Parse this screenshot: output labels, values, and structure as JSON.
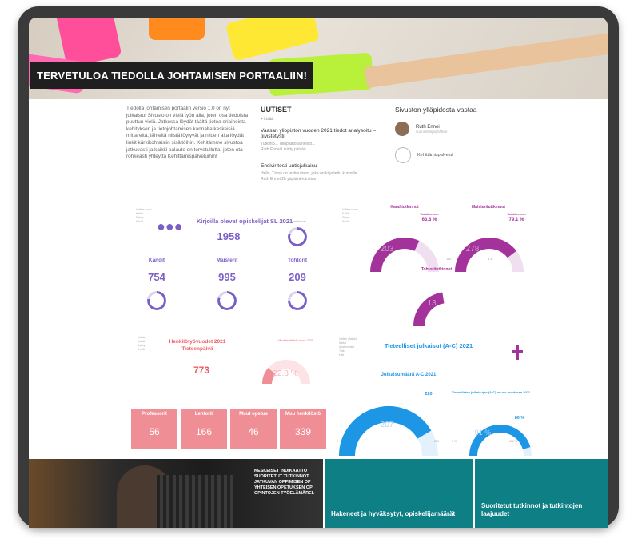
{
  "hero": {
    "title": "TERVETULOA TIEDOLLA JOHTAMISEN PORTAALIIN!"
  },
  "intro": {
    "text": "Tiedolla johtamisen portaalin versio 1.0 on nyt julkaistu! Sivusto on vielä työn alla, joten osa tiedoista puuttuu vielä. Jatkossa löydät täältä tietoa eriaiheista kehityksen ja tietojohtamisen kannalta keskeisiä mittareita, lähteitä niistä löytyvät ja niiden alta löydät linkit kärkikohtaisiin sisältöihin. Kehitämme sivustoa jatkuvasti ja kaikki palaute on tervetullutta, joten ota rohkeasti yhteyttä Kehittämispalveluihin!"
  },
  "news": {
    "heading": "UUTISET",
    "add_label": "+ Lisää",
    "items": [
      {
        "title": "Vaasan yliopiston vuoden 2021 tiedot analysoitu – tiivistetysti",
        "snippet": "Tutkinto... Tilinpäätösaineisto...",
        "author": "Ruth Ennei  Lisätty päivää"
      },
      {
        "title": "Ensivir testi uutisjulkaisu",
        "snippet": "Hello, Tämä on testiuutinen, joka on kirjoitettu kurssille...",
        "author": "Ruth Ennei  2h  yöpäivä-toimitus"
      }
    ]
  },
  "admins": {
    "heading": "Sivuston ylläpidosta vastaa",
    "people": [
      {
        "name": "Ruth Ennei",
        "role": "suunnittelija@lähde"
      },
      {
        "name": "Kehittämispalvelut",
        "role": ""
      }
    ]
  },
  "dashboard1": {
    "slicer": [
      "Valitse vuosi",
      "Kaikki",
      "Syksy",
      "Kevät"
    ],
    "title": "Kirjoilla olevat opiskelijat SL 2021",
    "total": "1958",
    "groups": [
      {
        "label": "Kandit",
        "value": "754",
        "pct": "78.2 %",
        "fraction": 0.78
      },
      {
        "label": "Maisterit",
        "value": "995",
        "pct": "79.6 %",
        "fraction": 0.8
      },
      {
        "label": "Tohtorit",
        "value": "209",
        "pct": "73.5 %",
        "fraction": 0.74
      }
    ],
    "total_pct": "80.1 %",
    "total_fraction": 0.8,
    "small_label": "Läsnäolevat"
  },
  "dashboard2": {
    "slicer": [
      "Valitse vuosi",
      "Kaikki",
      "Syksy",
      "Kevät"
    ],
    "gauges": [
      {
        "title": "Kanditutkinnot",
        "value": "203",
        "side": "Tavoitteeseen",
        "pct": "63.8 %",
        "fraction": 0.64
      },
      {
        "title": "Maisterituttkinnot",
        "value": "278",
        "side": "Tavoitteeseen",
        "pct": "79.1 %",
        "fraction": 0.79,
        "min": "164",
        "max": "1 k"
      },
      {
        "title": "Tohtoritutkinnot",
        "value": "13",
        "fraction": 0.45
      }
    ]
  },
  "dashboard3": {
    "slicer": [
      "Valitse",
      "Kaikki",
      "Syksy",
      "Kevät"
    ],
    "title_line1": "Henkilötyövuodet 2021",
    "title_line2": "Tieteenpäivä",
    "value": "773",
    "gauge_title": "Muut henkilöstö osuus 2021",
    "gauge_pct": "22.8 %",
    "gauge_fraction": 0.23,
    "tiles": [
      {
        "label": "Professorit",
        "value": "56"
      },
      {
        "label": "Lehtorit",
        "value": "166"
      },
      {
        "label": "Muut opetus",
        "value": "46"
      },
      {
        "label": "Muu henkilöstö",
        "value": "339"
      }
    ]
  },
  "dashboard4": {
    "slicer": [
      "Valitse yksikkö",
      "Kaikki",
      "Akateemiset",
      "Tutk.",
      "Hall."
    ],
    "title": "Tieteelliset julkaisut (A-C) 2021",
    "gauge1": {
      "title": "Julkaisumäärä A-C 2021",
      "value": "207",
      "target": "220",
      "min": "0",
      "max": "250",
      "fraction": 0.83
    },
    "gauge2": {
      "title": "Tieteellisten julkaisujen (A-C) osuus vuodessa 2021",
      "value": "91 %",
      "target": "80 %",
      "min": "0 %",
      "max": "100 %",
      "fraction": 0.91
    }
  },
  "bottom": {
    "text_lines": [
      "KESKEISET INDIKAATTO",
      "SUORITETUT TUTKINNOT",
      "JATKUVAN OPPIMISEN OP",
      "YHTEISEN OPETUKSEN OP",
      "OPINTOJEN TYÖELÄMÄREL"
    ],
    "tile1": "Hakeneet ja hyväksytyt, opiskelijamäärät",
    "tile2": "Suoritetut tutkinnot ja tutkintojen laajuudet"
  },
  "colors": {
    "purple": "#7b5fc7",
    "magenta": "#a4329b",
    "salmon": "#f08e96",
    "blue": "#1e96e6",
    "teal": "#0f7f86",
    "ring_grey": "#d9d2ec"
  }
}
